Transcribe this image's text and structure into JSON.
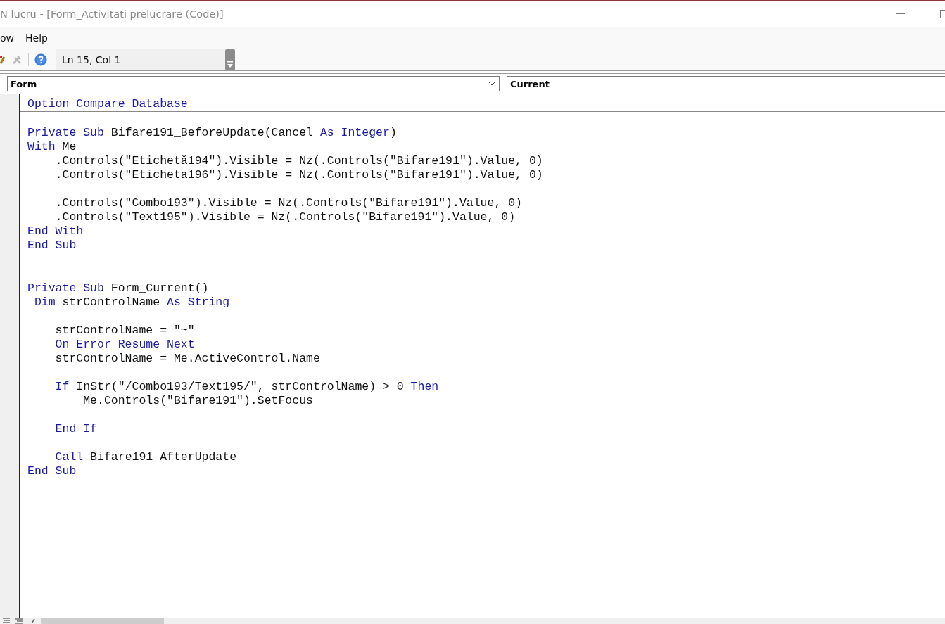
{
  "window": {
    "title": "N lucru - [Form_Activitati prelucrare (Code)]"
  },
  "menu": [
    "ow",
    "Help"
  ],
  "toolbar": {
    "position": "Ln 15, Col 1"
  },
  "object_box": {
    "value": "Form"
  },
  "procedure_box": {
    "value": "Current"
  },
  "procedures": [
    {
      "lines": [
        {
          "kind": "code",
          "tokens": [
            {
              "t": "Option Compare Database",
              "kind": "keyword"
            }
          ]
        }
      ]
    },
    {
      "lines": [
        {
          "kind": "blank"
        },
        {
          "kind": "code",
          "tokens": [
            {
              "t": "Private Sub",
              "kind": "keyword"
            },
            {
              "t": " Bifare191_BeforeUpdate(Cancel ",
              "kind": "code"
            },
            {
              "t": "As Integer",
              "kind": "keyword"
            },
            {
              "t": ")",
              "kind": "code"
            }
          ]
        },
        {
          "kind": "code",
          "tokens": [
            {
              "t": "With",
              "kind": "keyword"
            },
            {
              "t": " Me",
              "kind": "code"
            }
          ]
        },
        {
          "kind": "code",
          "tokens": [
            {
              "t": "    .Controls(\"Etichetă194\").Visible = Nz(.Controls(\"Bifare191\").Value, 0)",
              "kind": "code"
            }
          ]
        },
        {
          "kind": "code",
          "tokens": [
            {
              "t": "    .Controls(\"Eticheta196\").Visible = Nz(.Controls(\"Bifare191\").Value, 0)",
              "kind": "code"
            }
          ]
        },
        {
          "kind": "blank"
        },
        {
          "kind": "code",
          "tokens": [
            {
              "t": "    .Controls(\"Combo193\").Visible = Nz(.Controls(\"Bifare191\").Value, 0)",
              "kind": "code"
            }
          ]
        },
        {
          "kind": "code",
          "tokens": [
            {
              "t": "    .Controls(\"Text195\").Visible = Nz(.Controls(\"Bifare191\").Value, 0)",
              "kind": "code"
            }
          ]
        },
        {
          "kind": "code",
          "tokens": [
            {
              "t": "End With",
              "kind": "keyword"
            }
          ]
        },
        {
          "kind": "code",
          "tokens": [
            {
              "t": "End Sub",
              "kind": "keyword"
            }
          ]
        }
      ]
    },
    {
      "lines": [
        {
          "kind": "blank"
        },
        {
          "kind": "blank"
        },
        {
          "kind": "code",
          "tokens": [
            {
              "t": "Private Sub",
              "kind": "keyword"
            },
            {
              "t": " Form_Current()",
              "kind": "code"
            }
          ]
        },
        {
          "kind": "code",
          "caret": true,
          "tokens": [
            {
              "t": " Dim",
              "kind": "keyword"
            },
            {
              "t": " strControlName ",
              "kind": "code"
            },
            {
              "t": "As String",
              "kind": "keyword"
            }
          ]
        },
        {
          "kind": "blank"
        },
        {
          "kind": "code",
          "tokens": [
            {
              "t": "    strControlName = \"~\"",
              "kind": "code"
            }
          ]
        },
        {
          "kind": "code",
          "tokens": [
            {
              "t": "    On Error Resume Next",
              "kind": "keyword"
            }
          ]
        },
        {
          "kind": "code",
          "tokens": [
            {
              "t": "    strControlName = Me.ActiveControl.Name",
              "kind": "code"
            }
          ]
        },
        {
          "kind": "blank"
        },
        {
          "kind": "code",
          "tokens": [
            {
              "t": "    If",
              "kind": "keyword"
            },
            {
              "t": " InStr(\"/Combo193/Text195/\", strControlName) > 0 ",
              "kind": "code"
            },
            {
              "t": "Then",
              "kind": "keyword"
            }
          ]
        },
        {
          "kind": "code",
          "tokens": [
            {
              "t": "        Me.Controls(\"Bifare191\").SetFocus",
              "kind": "code"
            }
          ]
        },
        {
          "kind": "blank"
        },
        {
          "kind": "code",
          "tokens": [
            {
              "t": "    End If",
              "kind": "keyword"
            }
          ]
        },
        {
          "kind": "blank"
        },
        {
          "kind": "code",
          "tokens": [
            {
              "t": "    Call",
              "kind": "keyword"
            },
            {
              "t": " Bifare191_AfterUpdate",
              "kind": "code"
            }
          ]
        },
        {
          "kind": "code",
          "tokens": [
            {
              "t": "End Sub",
              "kind": "keyword"
            }
          ]
        }
      ]
    }
  ]
}
